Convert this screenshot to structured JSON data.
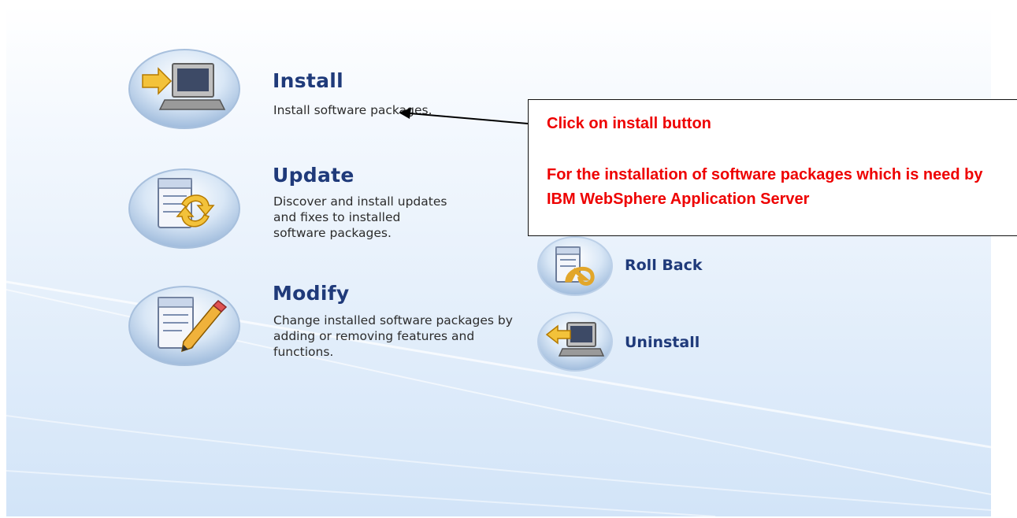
{
  "actions": {
    "install": {
      "title": "Install",
      "description": "Install software packages.",
      "icon": "computer-arrow-icon"
    },
    "update": {
      "title": "Update",
      "description": "Discover and install updates and fixes to installed software packages.",
      "icon": "package-refresh-icon"
    },
    "modify": {
      "title": "Modify",
      "description": "Change installed software packages by adding or removing features and functions.",
      "icon": "package-pencil-icon"
    },
    "rollback": {
      "title": "Roll Back",
      "icon": "package-rollback-icon"
    },
    "uninstall": {
      "title": "Uninstall",
      "icon": "computer-arrow-left-icon"
    }
  },
  "callout": {
    "line1": "Click on install button",
    "line2": "For the installation of software packages which is need by IBM WebSphere Application Server"
  },
  "colors": {
    "title": "#1f3a7a",
    "annotation": "#ee0000"
  }
}
